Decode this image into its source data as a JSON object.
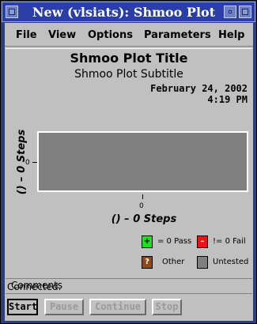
{
  "window": {
    "title": "New (vlsiats): Shmoo Plot"
  },
  "menu": [
    "File",
    "View",
    "Options",
    "Parameters",
    "Help"
  ],
  "plot": {
    "title": "Shmoo Plot Title",
    "subtitle": "Shmoo Plot Subtitle",
    "date": "February 24, 2002",
    "time": "4:19 PM",
    "ylabel": "() – 0 Steps",
    "xlabel": "() – 0 Steps",
    "ytick": "0",
    "xtick": "0"
  },
  "legend": [
    {
      "symbol": "+",
      "label": "= 0 Pass",
      "color": "#22dd22"
    },
    {
      "symbol": "–",
      "label": "!= 0 Fail",
      "color": "#ee1111"
    },
    {
      "symbol": "?",
      "label": "Other",
      "color": "#8a4a1a"
    },
    {
      "symbol": "",
      "label": "Untested",
      "color": "#808080"
    }
  ],
  "comments": "Comments",
  "status": "Connected.",
  "buttons": [
    {
      "label": "Start",
      "enabled": true
    },
    {
      "label": "Pause",
      "enabled": false
    },
    {
      "label": "Continue",
      "enabled": false
    },
    {
      "label": "Stop",
      "enabled": false
    }
  ],
  "colors": {
    "titlebar": "#2a3ea6",
    "background": "#c0c0c0",
    "plot_fill": "#808080"
  }
}
